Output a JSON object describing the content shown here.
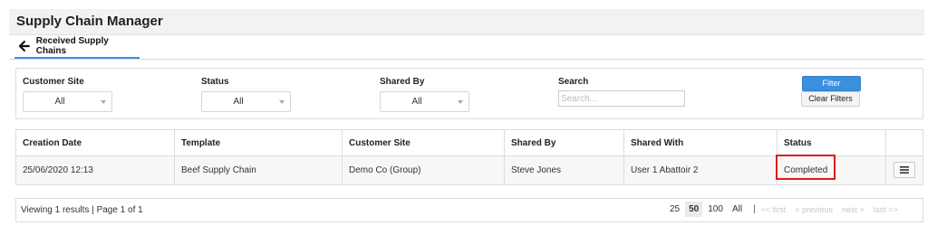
{
  "app": {
    "title": "Supply Chain Manager"
  },
  "nav": {
    "tab_label": "Received Supply Chains"
  },
  "filters": {
    "customer_site": {
      "label": "Customer Site",
      "value": "All"
    },
    "status": {
      "label": "Status",
      "value": "All"
    },
    "shared_by": {
      "label": "Shared By",
      "value": "All"
    },
    "search": {
      "label": "Search",
      "placeholder": "Search..."
    },
    "filter_button": "Filter",
    "clear_button": "Clear Filters"
  },
  "table": {
    "headers": [
      "Creation Date",
      "Template",
      "Customer Site",
      "Shared By",
      "Shared With",
      "Status"
    ],
    "rows": [
      [
        "25/06/2020 12:13",
        "Beef Supply Chain",
        "Demo Co (Group)",
        "Steve Jones",
        "User 1 Abattoir 2",
        "Completed"
      ]
    ]
  },
  "pager": {
    "info": "Viewing 1 results | Page 1 of 1",
    "sizes": [
      "25",
      "50",
      "100",
      "All"
    ],
    "active_size": "50",
    "separator": "|",
    "first": "<< first",
    "prev": "< previous",
    "next": "next >",
    "last": "last >>"
  },
  "colors": {
    "accent": "#3b8fdf",
    "highlight": "#e01a1a"
  }
}
